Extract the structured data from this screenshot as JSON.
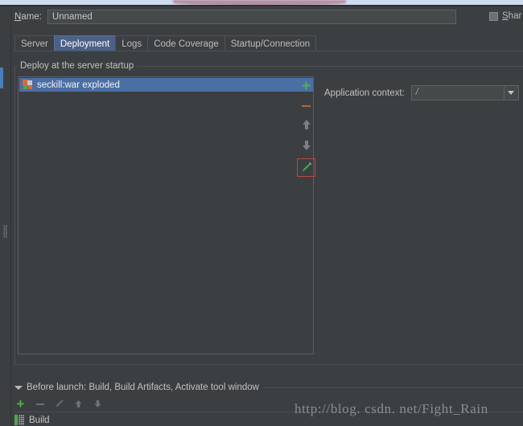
{
  "window": {
    "name_label": "Name:",
    "name_value": "Unnamed",
    "name_placeholder": "Unnamed",
    "share_label": "Share",
    "accent_color": "#4a6fa5",
    "background_color": "#3c3f41",
    "top_strip_color": "#cdddef",
    "top_strip_blob_color": "#b58b9c"
  },
  "tabs": [
    {
      "label": "Server",
      "selected": false
    },
    {
      "label": "Deployment",
      "selected": true
    },
    {
      "label": "Logs",
      "selected": false
    },
    {
      "label": "Code Coverage",
      "selected": false
    },
    {
      "label": "Startup/Connection",
      "selected": false
    }
  ],
  "deployment": {
    "group_label": "Deploy at the server startup",
    "items": [
      {
        "label": "seckill:war exploded",
        "icon": "artifact-icon",
        "selected": true
      }
    ],
    "toolbar": [
      {
        "name": "add-button",
        "glyph": "+",
        "enabled": true,
        "color": "#4fb04f"
      },
      {
        "name": "remove-button",
        "glyph": "–",
        "enabled": true,
        "color": "#b5653e"
      },
      {
        "name": "move-up-button",
        "glyph": "↑",
        "enabled": false,
        "color": "#7c8084"
      },
      {
        "name": "move-down-button",
        "glyph": "↓",
        "enabled": false,
        "color": "#7c8084"
      },
      {
        "name": "edit-button",
        "glyph": "✎",
        "enabled": true,
        "color": "#4fb04f",
        "highlight_border": "#b14a4a"
      }
    ],
    "application_context_label": "Application context:",
    "application_context_value": "/"
  },
  "before_launch": {
    "title": "Before launch: Build, Build Artifacts, Activate tool window",
    "toolbar": [
      {
        "name": "add-task-button",
        "glyph": "+",
        "enabled": true
      },
      {
        "name": "remove-task-button",
        "glyph": "–",
        "enabled": false
      },
      {
        "name": "edit-task-button",
        "glyph": "✎",
        "enabled": false
      },
      {
        "name": "move-task-up-button",
        "glyph": "↑",
        "enabled": false
      },
      {
        "name": "move-task-down-button",
        "glyph": "↓",
        "enabled": false
      }
    ],
    "tasks": [
      {
        "label": "Build",
        "icon": "build-icon"
      }
    ]
  },
  "watermark": {
    "text": "http://blog. csdn. net/Fight_Rain"
  }
}
